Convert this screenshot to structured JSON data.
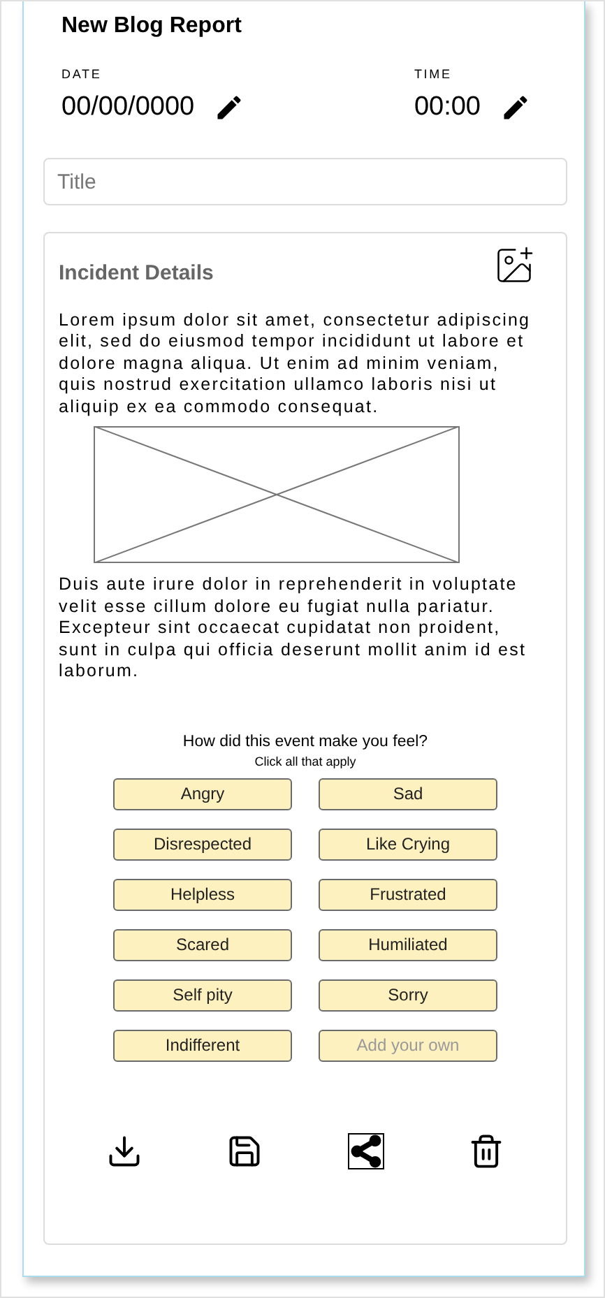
{
  "header": {
    "title": "New Blog Report"
  },
  "date": {
    "label": "DATE",
    "value": "00/00/0000"
  },
  "time": {
    "label": "TIME",
    "value": "00:00"
  },
  "title_field": {
    "placeholder": "Title"
  },
  "details": {
    "heading": "Incident Details",
    "paragraphs": [
      "Lorem ipsum dolor sit amet, consectetur adipiscing elit, sed do eiusmod tempor incididunt ut labore et dolore magna aliqua. Ut enim ad minim veniam, quis nostrud exercitation ullamco laboris nisi ut aliquip ex ea commodo consequat.",
      "Duis aute irure dolor in reprehenderit in voluptate velit esse cillum dolore eu fugiat nulla pariatur. Excepteur sint occaecat cupidatat non proident, sunt in culpa qui officia deserunt mollit anim id est laborum."
    ]
  },
  "feelings": {
    "question": "How did this event make you feel?",
    "hint": "Click all that apply",
    "options": [
      {
        "kind": "button",
        "label": "Angry"
      },
      {
        "kind": "button",
        "label": "Sad"
      },
      {
        "kind": "button",
        "label": "Disrespected"
      },
      {
        "kind": "button",
        "label": "Like Crying"
      },
      {
        "kind": "button",
        "label": "Helpless"
      },
      {
        "kind": "button",
        "label": "Frustrated"
      },
      {
        "kind": "button",
        "label": "Scared"
      },
      {
        "kind": "button",
        "label": "Humiliated"
      },
      {
        "kind": "button",
        "label": "Self pity"
      },
      {
        "kind": "button",
        "label": "Sorry"
      },
      {
        "kind": "button",
        "label": "Indifferent"
      },
      {
        "kind": "input",
        "placeholder": "Add your own"
      }
    ]
  },
  "actions": [
    {
      "kind": "download"
    },
    {
      "kind": "save"
    },
    {
      "kind": "share"
    },
    {
      "kind": "delete"
    }
  ]
}
